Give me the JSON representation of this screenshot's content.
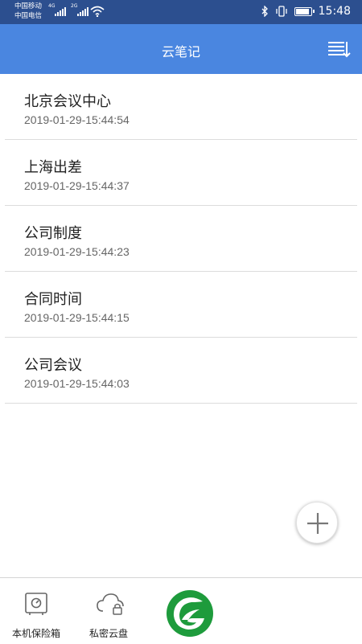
{
  "status_bar": {
    "carrier1": "中国移动",
    "carrier2": "中国电信",
    "net1": "4G",
    "net2": "2G",
    "time": "15:48",
    "battery_level": 0.9
  },
  "header": {
    "title": "云笔记",
    "menu_icon": "list-menu-icon"
  },
  "notes": [
    {
      "title": "北京会议中心",
      "time": "2019-01-29-15:44:54"
    },
    {
      "title": "上海出差",
      "time": "2019-01-29-15:44:37"
    },
    {
      "title": "公司制度",
      "time": "2019-01-29-15:44:23"
    },
    {
      "title": "合同时间",
      "time": "2019-01-29-15:44:15"
    },
    {
      "title": "公司会议",
      "time": "2019-01-29-15:44:03"
    }
  ],
  "fab": {
    "icon": "plus-icon"
  },
  "bottom_nav": {
    "items": [
      {
        "label": "本机保险箱",
        "icon": "safe-icon"
      },
      {
        "label": "私密云盘",
        "icon": "cloud-lock-icon"
      }
    ],
    "logo": "app-logo-icon"
  },
  "colors": {
    "status_bar": "#2c4f8f",
    "app_bar": "#4a86e0",
    "logo_green": "#1e9b3c"
  }
}
